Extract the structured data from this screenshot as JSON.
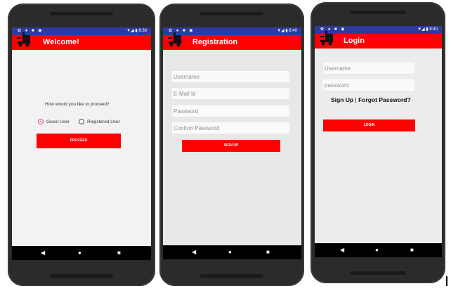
{
  "status_bar": {
    "time1": "8:38",
    "time2": "8:40",
    "time3": "8:40"
  },
  "screen_welcome": {
    "title": "Welcome!",
    "question": "How would you like to proceed?",
    "radio_guest": "Guest User",
    "radio_registered": "Registered User",
    "proceed_button": "PROCEED"
  },
  "screen_registration": {
    "title": "Registration",
    "username_placeholder": "Username",
    "email_placeholder": "E-Mail Id",
    "password_placeholder": "Password",
    "confirm_password_placeholder": "Confirm Password",
    "signup_button": "SIGN UP"
  },
  "screen_login": {
    "title": "Login",
    "username_placeholder": "Username",
    "password_placeholder": "password",
    "signup_link": "Sign Up",
    "separator": "|",
    "forgot_link": "Forgot Password?",
    "login_button": "LOGIN"
  },
  "nav": {
    "back": "◀",
    "home": "●",
    "recent": "■"
  },
  "colors": {
    "appbar": "#ff0000",
    "statusbar": "#2d3aa0",
    "accent": "#ff4081"
  }
}
